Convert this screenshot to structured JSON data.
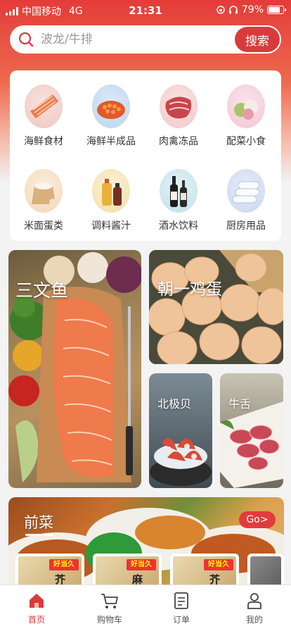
{
  "status_bar": {
    "carrier": "中国移动",
    "network": "4G",
    "time": "21:31",
    "battery": "79%",
    "battery_level": 0.79
  },
  "search": {
    "placeholder": "波龙/牛排",
    "button_label": "搜索"
  },
  "categories": [
    {
      "label": "海鲜食材",
      "icon": "salmon-icon"
    },
    {
      "label": "海鲜半成品",
      "icon": "roe-icon"
    },
    {
      "label": "肉禽冻品",
      "icon": "steak-icon"
    },
    {
      "label": "配菜小食",
      "icon": "mochi-icon"
    },
    {
      "label": "米面蛋类",
      "icon": "rice-icon"
    },
    {
      "label": "调料酱汁",
      "icon": "oil-bottle-icon"
    },
    {
      "label": "酒水饮料",
      "icon": "sake-bottle-icon"
    },
    {
      "label": "厨房用品",
      "icon": "cling-film-icon"
    }
  ],
  "tiles": {
    "salmon": {
      "title": "三文鱼"
    },
    "eggs": {
      "title": "朝一鸡蛋"
    },
    "surf_clam": {
      "title": "北极贝"
    },
    "beef_tongue": {
      "title": "牛舌"
    }
  },
  "appetizer": {
    "title": "前菜",
    "go_label": "Go>",
    "products": [
      {
        "badge": "好当久",
        "char": "芥"
      },
      {
        "badge": "好当久",
        "char": "麻"
      },
      {
        "badge": "好当久",
        "char": "芥"
      }
    ]
  },
  "tabbar": [
    {
      "label": "首页",
      "icon": "home-icon",
      "active": true
    },
    {
      "label": "购物车",
      "icon": "cart-icon",
      "active": false
    },
    {
      "label": "订单",
      "icon": "order-icon",
      "active": false
    },
    {
      "label": "我的",
      "icon": "profile-icon",
      "active": false
    }
  ],
  "colors": {
    "brand": "#d93b3b",
    "header": "#e33c3a"
  }
}
